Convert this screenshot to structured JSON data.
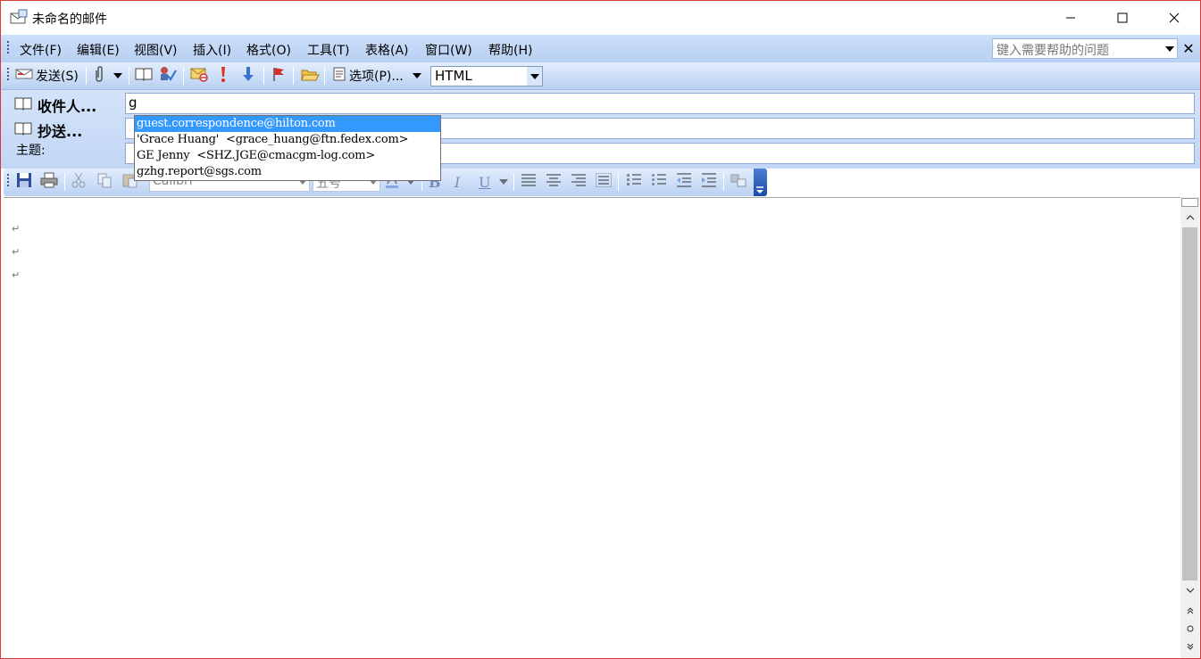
{
  "window": {
    "title": "未命名的邮件",
    "controls": {
      "minimize": "minimize",
      "maximize": "maximize",
      "close": "close"
    }
  },
  "menu": {
    "items": [
      "文件(F)",
      "编辑(E)",
      "视图(V)",
      "插入(I)",
      "格式(O)",
      "工具(T)",
      "表格(A)",
      "窗口(W)",
      "帮助(H)"
    ],
    "help_placeholder": "键入需要帮助的问题",
    "help_close": "✕"
  },
  "toolbar": {
    "send_label": "发送(S)",
    "options_label": "选项(P)...",
    "format_value": "HTML"
  },
  "header": {
    "to_label": "收件人...",
    "cc_label": "抄送...",
    "subject_label": "主题:",
    "to_value": "g",
    "cc_value": "",
    "subject_value": ""
  },
  "autocomplete": {
    "items": [
      "guest.correspondence@hilton.com",
      "'Grace Huang'  <grace_huang@ftn.fedex.com>",
      "GE Jenny  <SHZ.JGE@cmacgm-log.com>",
      "gzhg.report@sgs.com"
    ],
    "selected_index": 0
  },
  "format_toolbar": {
    "font_name": "Calibri",
    "font_size": "五号"
  },
  "body": {
    "paragraph_mark": "↵"
  },
  "colors": {
    "menubar": "#c6dbf7",
    "selection": "#3399ff",
    "toolbar_tail": "#2b5bbd"
  }
}
